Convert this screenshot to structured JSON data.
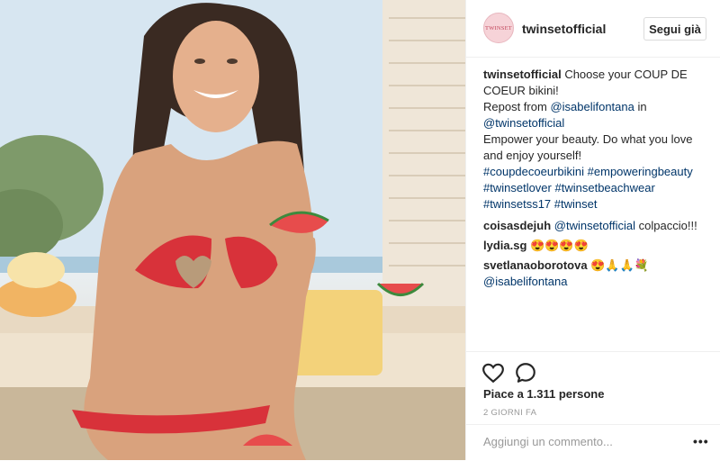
{
  "post": {
    "username": "twinsetofficial",
    "avatar_text": "TWINSET",
    "follow_label": "Segui già",
    "caption": {
      "user": "twinsetofficial",
      "lines": [
        "Choose your COUP DE COEUR bikini!",
        "Repost from",
        "@isabelifontana",
        "in",
        "@twinsetofficial",
        "Empower your beauty. Do what you love and enjoy yourself!",
        "#coupdecoeurbikini",
        "#empoweringbeauty",
        "#twinsetlover",
        "#twinsetbeachwear",
        "#twinsetss17",
        "#twinset"
      ]
    },
    "comments": [
      {
        "user": "coisasdejuh",
        "mention": "@twinsetofficial",
        "text": "colpaccio!!!"
      },
      {
        "user": "lydia.sg",
        "text": "😍😍😍😍"
      },
      {
        "user": "svetlanaoborotova",
        "text": "😍🙏🙏💐",
        "mention": "@isabelifontana"
      }
    ],
    "likes": "Piace a 1.311 persone",
    "time": "2 GIORNI FA",
    "comment_placeholder": "Aggiungi un commento...",
    "more_label": "•••"
  },
  "icons": {
    "like": "heart-icon",
    "comment": "speech-bubble-icon",
    "more": "more-options-icon"
  },
  "colors": {
    "link": "#003569",
    "border": "#efefef",
    "muted": "#999999",
    "bikini": "#d8323a"
  }
}
